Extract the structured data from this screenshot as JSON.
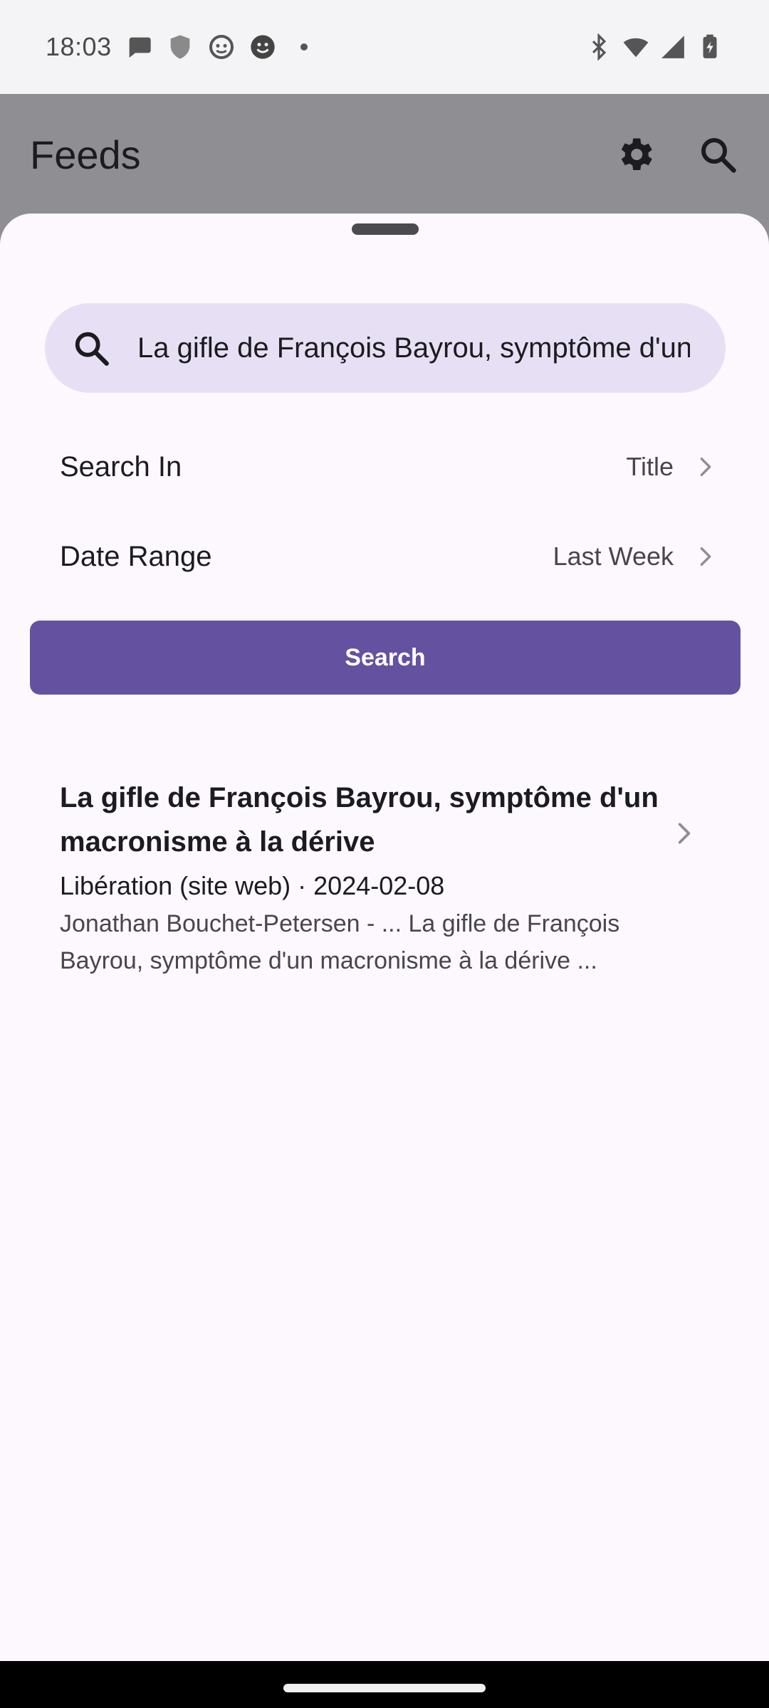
{
  "status_bar": {
    "time": "18:03",
    "notification_icons": [
      "chat-bubble-icon",
      "shield-app-icon",
      "face-app-icon",
      "smiley-app-icon",
      "more-dot-icon"
    ],
    "system_icons": [
      "bluetooth-icon",
      "wifi-icon",
      "signal-icon",
      "battery-charging-icon"
    ]
  },
  "app_bar": {
    "title": "Feeds",
    "actions": [
      "settings-icon",
      "search-icon"
    ]
  },
  "search": {
    "query": "La gifle de François Bayrou, symptôme d'un macronisme à la dérive"
  },
  "options": [
    {
      "label": "Search In",
      "value": "Title"
    },
    {
      "label": "Date Range",
      "value": "Last Week"
    }
  ],
  "search_button": {
    "label": "Search"
  },
  "results": [
    {
      "title": "La gifle de François Bayrou, symptôme d'un macronisme à la dérive",
      "meta": "Libération (site web) · 2024-02-08",
      "snippet": "Jonathan Bouchet-Petersen - ... La gifle de François Bayrou, symptôme d'un macronisme à la dérive ..."
    }
  ],
  "colors": {
    "accent": "#6451a0",
    "search_bar_bg": "#e7e0f5",
    "sheet_bg": "#fdf8fd",
    "scrim": "#8f8e93"
  }
}
